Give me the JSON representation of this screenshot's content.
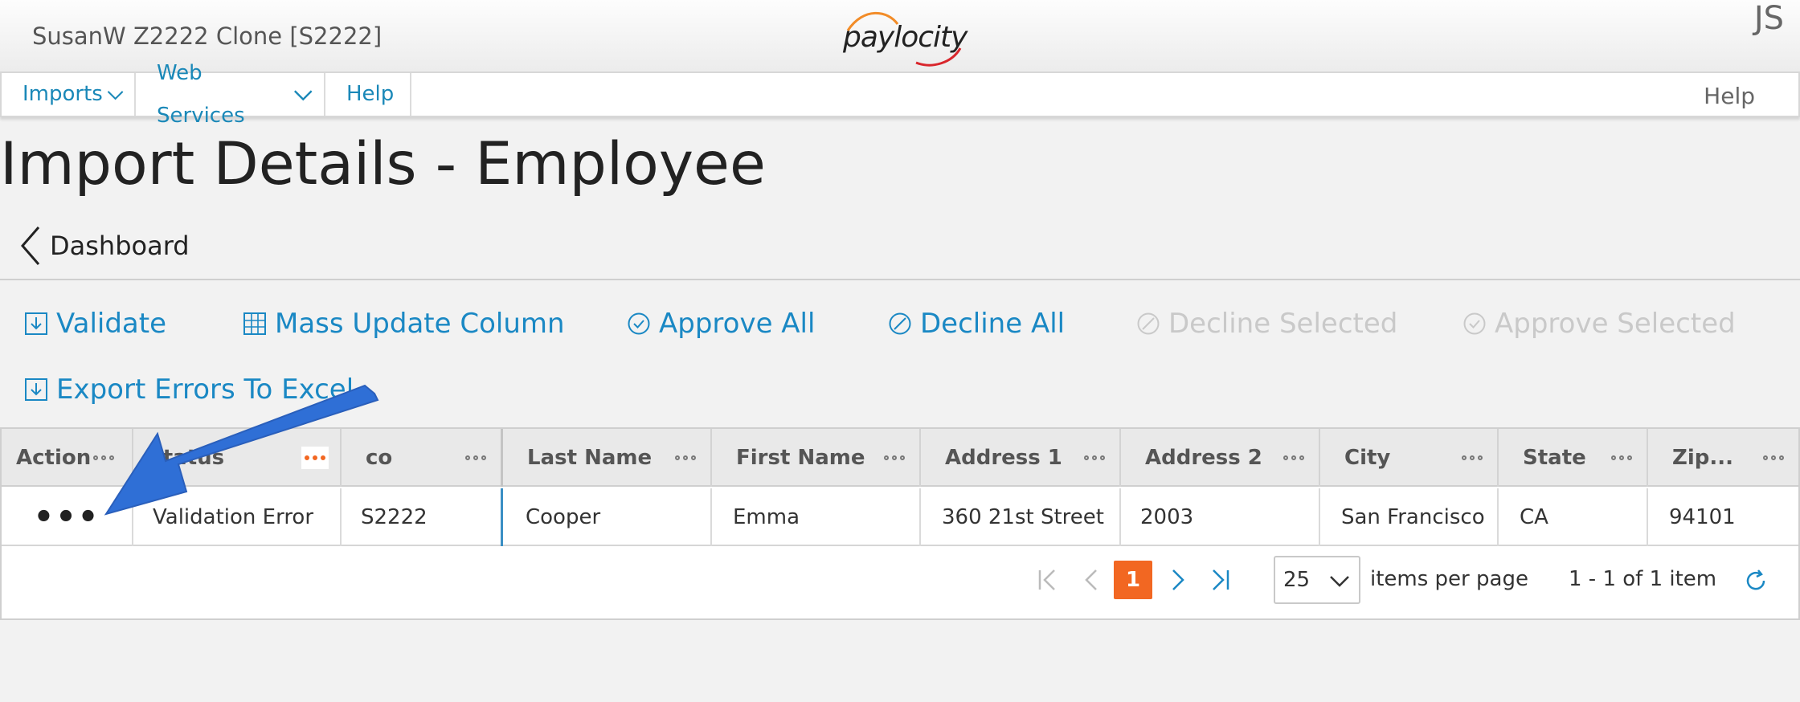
{
  "header": {
    "company": "SusanW Z2222 Clone [S2222]",
    "logo_text": "paylocity",
    "user_initials": "JS"
  },
  "nav": {
    "items": [
      {
        "label": "Imports",
        "has_dropdown": true
      },
      {
        "label": "Web Services",
        "has_dropdown": true
      },
      {
        "label": "Help",
        "has_dropdown": false
      }
    ],
    "help_right": "Help"
  },
  "page": {
    "title": "Import Details - Employee",
    "back_label": "Dashboard"
  },
  "toolbar": {
    "validate": "Validate",
    "mass_update": "Mass Update Column",
    "approve_all": "Approve All",
    "decline_all": "Decline All",
    "decline_selected": "Decline Selected",
    "approve_selected": "Approve Selected",
    "export_errors": "Export Errors To Excel"
  },
  "grid": {
    "columns": [
      "Action",
      "Status",
      "co",
      "Last Name",
      "First Name",
      "Address 1",
      "Address 2",
      "City",
      "State",
      "Zip..."
    ],
    "rows": [
      {
        "action": "•••",
        "status": "Validation Error",
        "co": "S2222",
        "last_name": "Cooper",
        "first_name": "Emma",
        "address1": "360 21st Street",
        "address2": "2003",
        "city": "San Francisco",
        "state": "CA",
        "zip": "94101"
      }
    ]
  },
  "pager": {
    "current_page": "1",
    "page_size": "25",
    "items_per_page_label": "items per page",
    "info": "1 - 1 of 1 item"
  },
  "colors": {
    "accent": "#1a88c4",
    "orange": "#f26722",
    "annotation_arrow": "#2f6fd6"
  }
}
